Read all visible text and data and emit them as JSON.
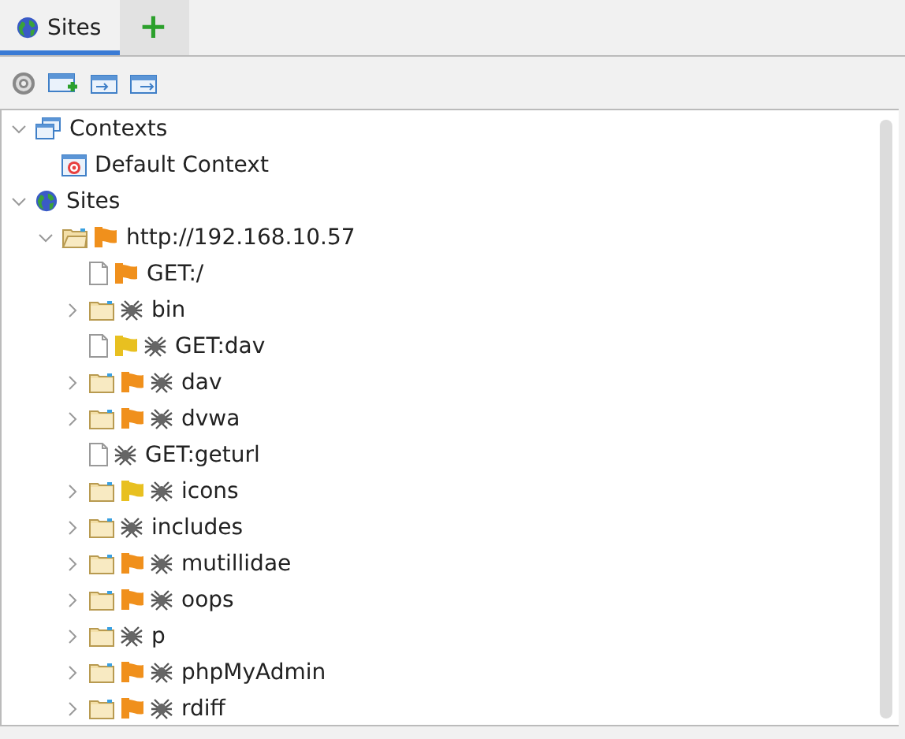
{
  "tabs": [
    {
      "kind": "sites",
      "label": "Sites",
      "selected": true
    },
    {
      "kind": "add",
      "label": "+",
      "selected": false
    }
  ],
  "tree": [
    {
      "kind": "contexts",
      "label": "Contexts",
      "expanded": true,
      "children": [
        {
          "kind": "context",
          "label": "Default Context"
        }
      ]
    },
    {
      "kind": "sites",
      "label": "Sites",
      "expanded": true,
      "children": [
        {
          "kind": "folder",
          "label": "http://192.168.10.57",
          "expanded": true,
          "flag": {
            "color": "#f0901c"
          },
          "spidered": false,
          "children": [
            {
              "kind": "file",
              "label": "GET:/",
              "flag": {
                "color": "#f0901c"
              },
              "spidered": false
            },
            {
              "kind": "folder",
              "label": "bin",
              "expanded": false,
              "spidered": true
            },
            {
              "kind": "file",
              "label": "GET:dav",
              "flag": {
                "color": "#e8c020"
              },
              "spidered": true
            },
            {
              "kind": "folder",
              "label": "dav",
              "expanded": false,
              "flag": {
                "color": "#f0901c"
              },
              "spidered": true
            },
            {
              "kind": "folder",
              "label": "dvwa",
              "expanded": false,
              "flag": {
                "color": "#f0901c"
              },
              "spidered": true
            },
            {
              "kind": "file",
              "label": "GET:geturl",
              "spidered": true
            },
            {
              "kind": "folder",
              "label": "icons",
              "expanded": false,
              "flag": {
                "color": "#e8c020"
              },
              "spidered": true
            },
            {
              "kind": "folder",
              "label": "includes",
              "expanded": false,
              "spidered": true
            },
            {
              "kind": "folder",
              "label": "mutillidae",
              "expanded": false,
              "flag": {
                "color": "#f0901c"
              },
              "spidered": true
            },
            {
              "kind": "folder",
              "label": "oops",
              "expanded": false,
              "flag": {
                "color": "#f0901c"
              },
              "spidered": true
            },
            {
              "kind": "folder",
              "label": "p",
              "expanded": false,
              "spidered": true
            },
            {
              "kind": "folder",
              "label": "phpMyAdmin",
              "expanded": false,
              "flag": {
                "color": "#f0901c"
              },
              "spidered": true
            },
            {
              "kind": "folder",
              "label": "rdiff",
              "expanded": false,
              "flag": {
                "color": "#f0901c"
              },
              "spidered": true
            }
          ]
        }
      ]
    }
  ]
}
